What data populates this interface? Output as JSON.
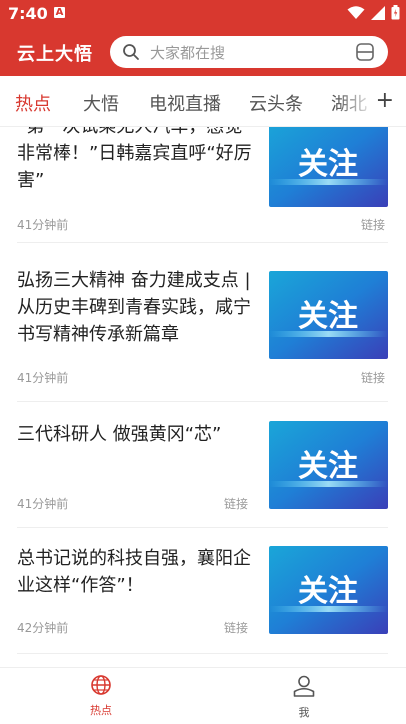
{
  "status_bar": {
    "time": "7:40",
    "notification_icon_letter": "A"
  },
  "header": {
    "app_title": "云上大悟",
    "search_placeholder": "大家都在搜"
  },
  "tabs": [
    {
      "label": "热点",
      "active": true
    },
    {
      "label": "大悟",
      "active": false
    },
    {
      "label": "电视直播",
      "active": false
    },
    {
      "label": "云头条",
      "active": false
    },
    {
      "label": "湖北",
      "active": false
    }
  ],
  "tab_add_label": "+",
  "thumbnail_text": "关注",
  "articles": [
    {
      "title": "“第一次试乘无人汽车，感觉非常棒！”日韩嘉宾直呼“好厉害”",
      "time": "41分钟前",
      "link": "链接"
    },
    {
      "title": "弘扬三大精神 奋力建成支点 | 从历史丰碑到青春实践，咸宁书写精神传承新篇章",
      "time": "41分钟前",
      "link": "链接"
    },
    {
      "title": "三代科研人 做强黄冈“芯”",
      "time": "41分钟前",
      "link": "链接"
    },
    {
      "title": "总书记说的科技自强，襄阳企业这样“作答”！",
      "time": "42分钟前",
      "link": "链接"
    }
  ],
  "bottom_nav": [
    {
      "label": "热点",
      "icon": "globe-icon",
      "active": true
    },
    {
      "label": "我",
      "icon": "person-icon",
      "active": false
    }
  ],
  "colors": {
    "brand": "#d8382f",
    "text": "#222222",
    "muted": "#999999"
  }
}
